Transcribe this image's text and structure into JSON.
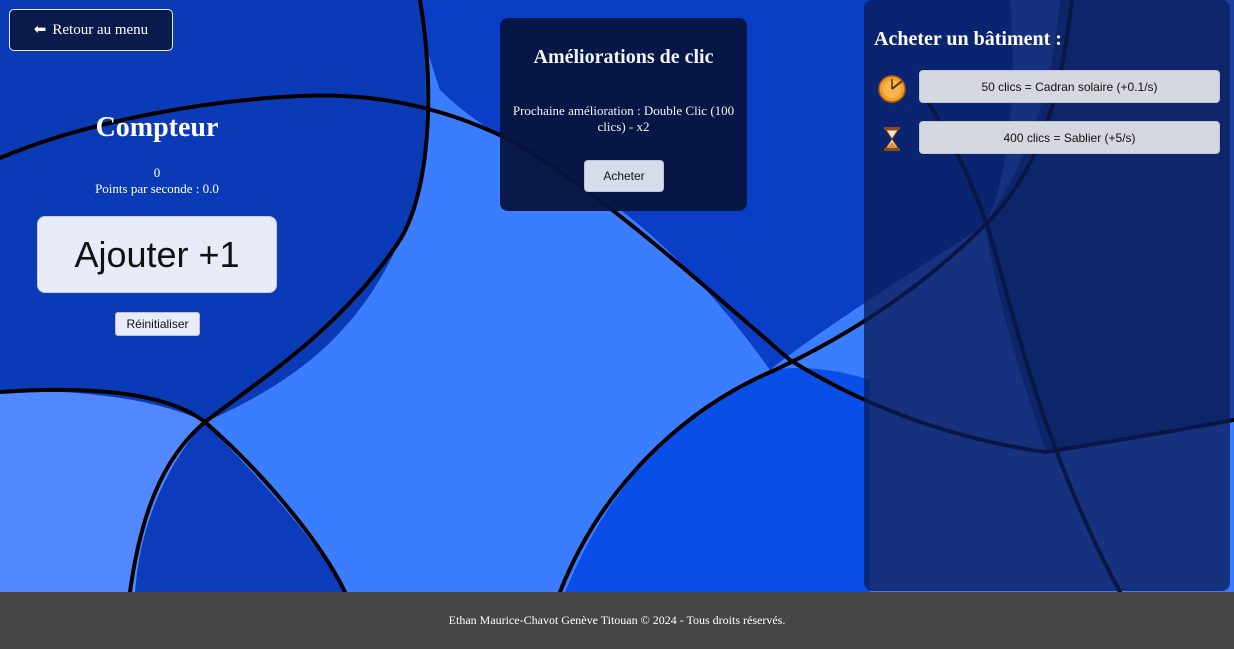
{
  "nav": {
    "back_label": "Retour au menu",
    "back_icon": "arrow-left-icon"
  },
  "counter": {
    "title": "Compteur",
    "value": "0",
    "pps_text": "Points par seconde : 0.0",
    "add_label": "Ajouter +1",
    "reset_label": "Réinitialiser"
  },
  "upgrades": {
    "title": "Améliorations de clic",
    "next_text": "Prochaine amélioration : Double Clic (100 clics) - x2",
    "buy_label": "Acheter"
  },
  "buildings": {
    "title": "Acheter un bâtiment :",
    "items": [
      {
        "icon": "sundial-icon",
        "label": "50 clics = Cadran solaire (+0.1/s)"
      },
      {
        "icon": "hourglass-icon",
        "label": "400 clics = Sablier (+5/s)"
      }
    ]
  },
  "footer": {
    "text": "Ethan Maurice-Chavot Genève Titouan © 2024 - Tous droits réservés."
  },
  "colors": {
    "background": "#3b7dff",
    "dark_region": "#0a35a8",
    "panel": "#06143f",
    "footer": "#464646"
  }
}
